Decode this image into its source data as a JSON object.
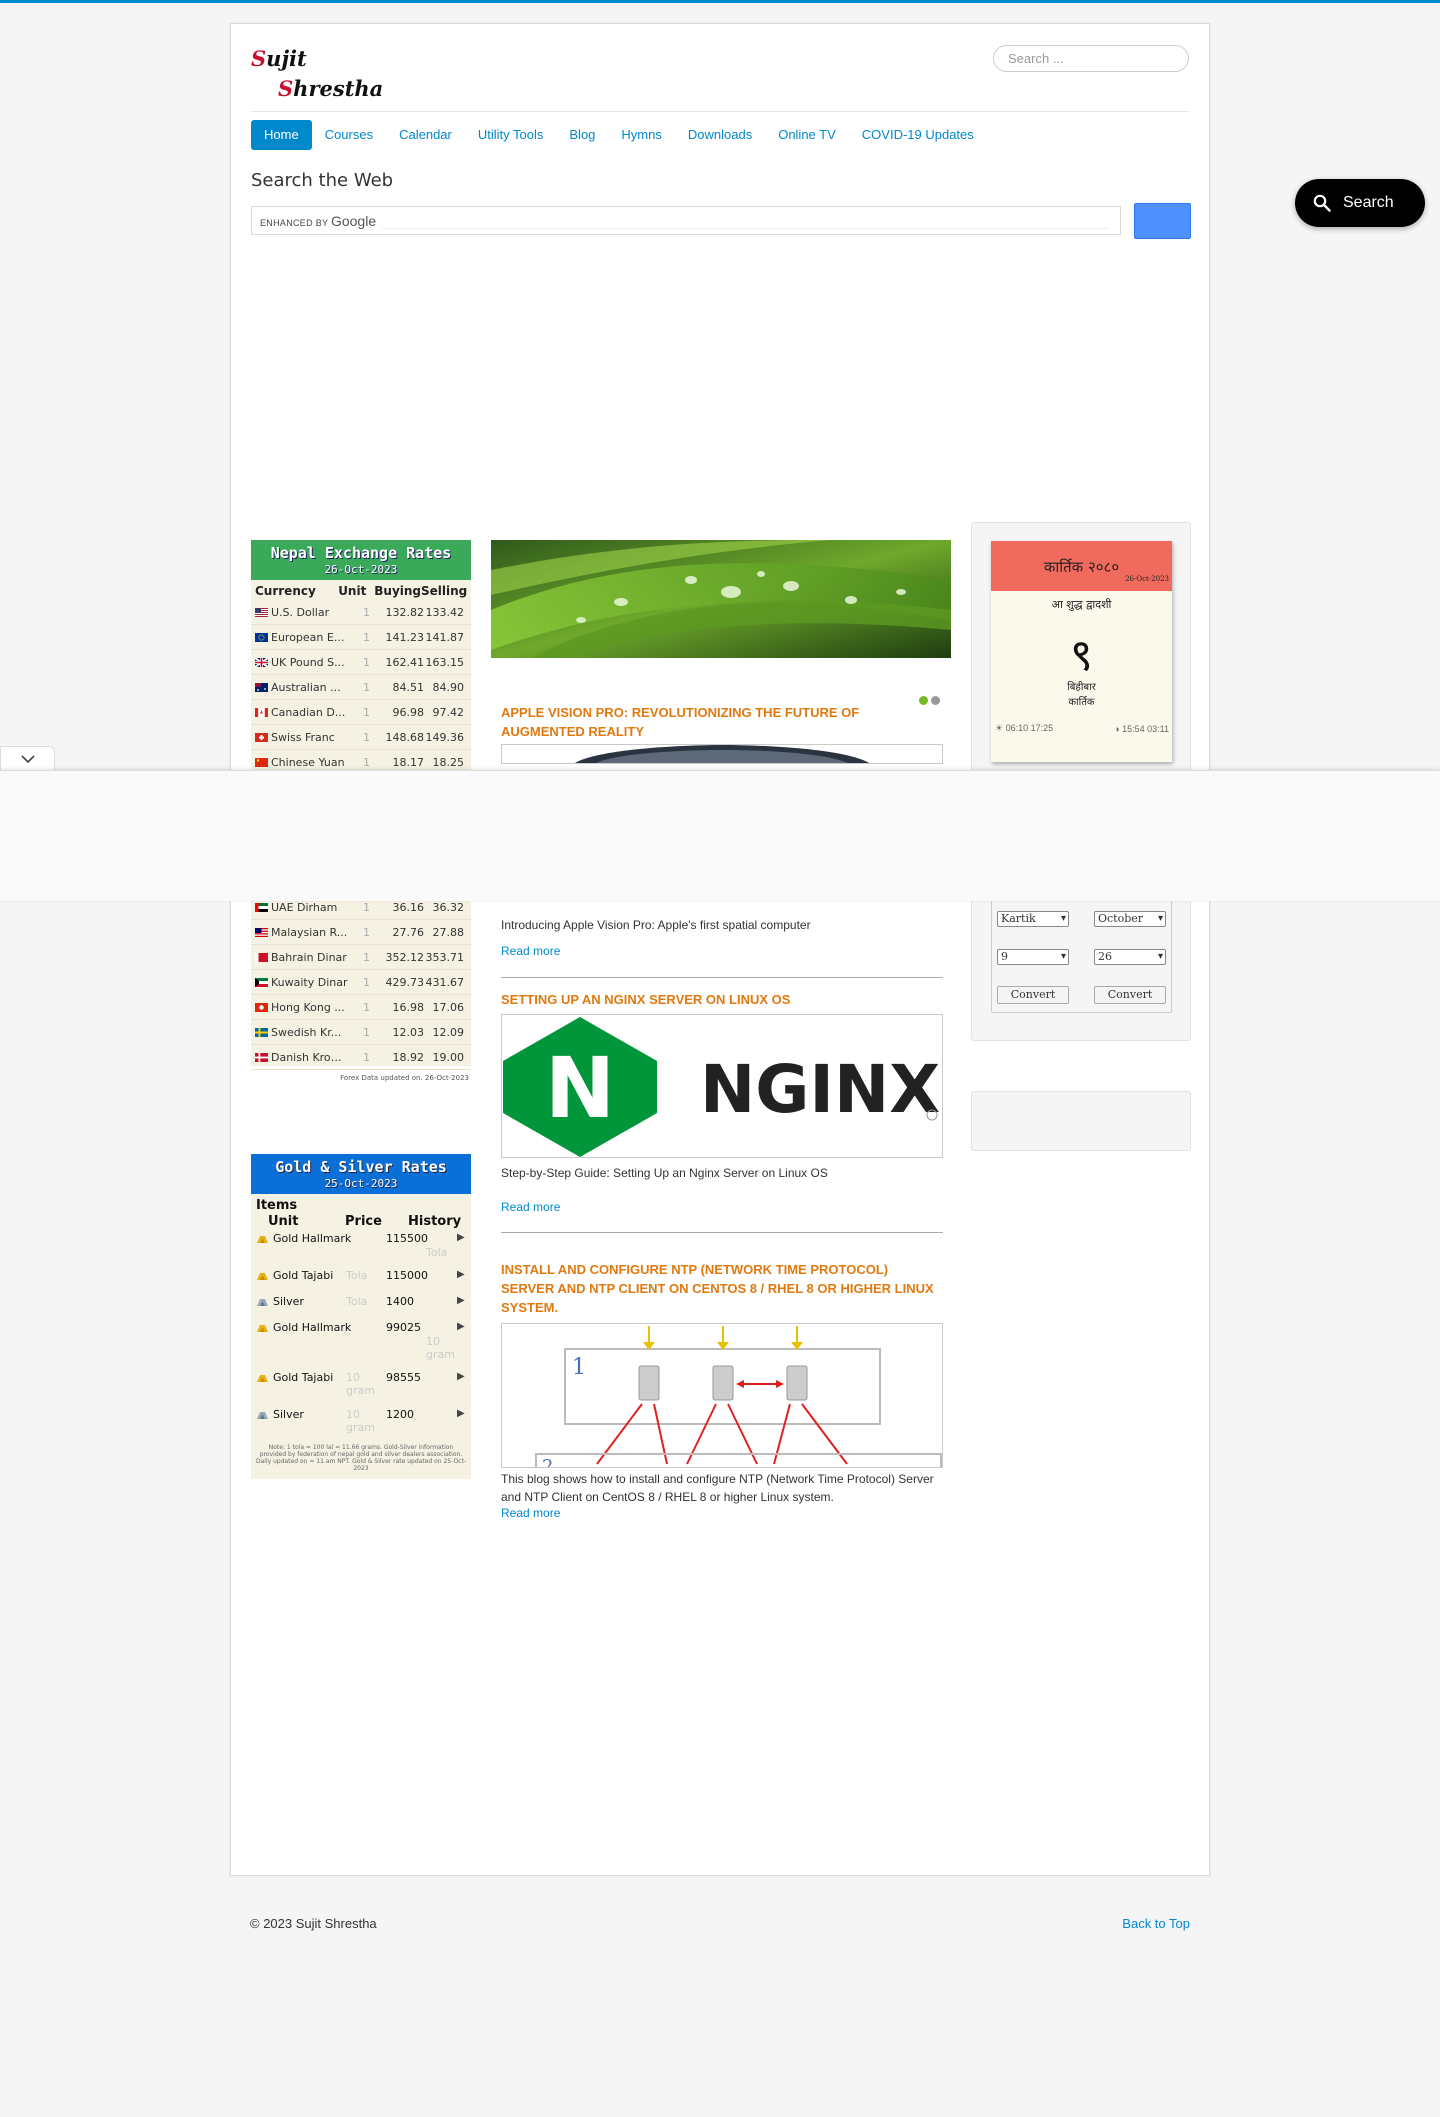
{
  "header": {
    "brand_line1_cap": "S",
    "brand_line1_rest": "ujit",
    "brand_line2_cap": "S",
    "brand_line2_rest": "hrestha",
    "search_placeholder": "Search ..."
  },
  "nav": {
    "items": [
      {
        "label": "Home"
      },
      {
        "label": "Courses"
      },
      {
        "label": "Calendar"
      },
      {
        "label": "Utility Tools"
      },
      {
        "label": "Blog"
      },
      {
        "label": "Hymns"
      },
      {
        "label": "Downloads"
      },
      {
        "label": "Online TV"
      },
      {
        "label": "COVID-19 Updates"
      }
    ]
  },
  "search_web": {
    "title": "Search the Web",
    "enhanced_by": "ENHANCED BY",
    "google": "Google"
  },
  "float_search": {
    "label": "Search"
  },
  "forex": {
    "title": "Nepal Exchange Rates",
    "date": "26-Oct-2023",
    "col_currency": "Currency",
    "col_unit": "Unit",
    "col_buying": "Buying",
    "col_selling": "Selling",
    "rows": [
      {
        "name": "U.S. Dollar",
        "unit": "1",
        "buy": "132.82",
        "sell": "133.42",
        "flag": "us"
      },
      {
        "name": "European E...",
        "unit": "1",
        "buy": "141.23",
        "sell": "141.87",
        "flag": "eu"
      },
      {
        "name": "UK Pound S...",
        "unit": "1",
        "buy": "162.41",
        "sell": "163.15",
        "flag": "uk"
      },
      {
        "name": "Australian ...",
        "unit": "1",
        "buy": "84.51",
        "sell": "84.90",
        "flag": "au"
      },
      {
        "name": "Canadian D...",
        "unit": "1",
        "buy": "96.98",
        "sell": "97.42",
        "flag": "ca"
      },
      {
        "name": "Swiss Franc",
        "unit": "1",
        "buy": "148.68",
        "sell": "149.36",
        "flag": "ch"
      },
      {
        "name": "Chinese Yuan",
        "unit": "1",
        "buy": "18.17",
        "sell": "18.25",
        "flag": "cn"
      }
    ],
    "rows2": [
      {
        "name": "UAE Dirham",
        "unit": "1",
        "buy": "36.16",
        "sell": "36.32",
        "flag": "ae"
      },
      {
        "name": "Malaysian R...",
        "unit": "1",
        "buy": "27.76",
        "sell": "27.88",
        "flag": "my"
      },
      {
        "name": "Bahrain Dinar",
        "unit": "1",
        "buy": "352.12",
        "sell": "353.71",
        "flag": "bh"
      },
      {
        "name": "Kuwaity Dinar",
        "unit": "1",
        "buy": "429.73",
        "sell": "431.67",
        "flag": "kw"
      },
      {
        "name": "Hong Kong ...",
        "unit": "1",
        "buy": "16.98",
        "sell": "17.06",
        "flag": "hk"
      },
      {
        "name": "Swedish Kr...",
        "unit": "1",
        "buy": "12.03",
        "sell": "12.09",
        "flag": "se"
      },
      {
        "name": "Danish Kron...",
        "unit": "1",
        "buy": "18.92",
        "sell": "19.00",
        "flag": "dk"
      }
    ],
    "footer": "Forex Data updated on. 26-Oct-2023"
  },
  "gold": {
    "title": "Gold & Silver Rates",
    "date": "25-Oct-2023",
    "col_items": "Items",
    "col_unit": "Unit",
    "col_price": "Price",
    "col_history": "History",
    "rows": [
      {
        "name": "Gold Hallmark",
        "unit": "Tola",
        "price": "115500"
      },
      {
        "name": "Gold Tajabi",
        "unit": "Tola",
        "price": "115000"
      },
      {
        "name": "Silver",
        "unit": "Tola",
        "price": "1400"
      },
      {
        "name": "Gold Hallmark",
        "unit": "10 gram",
        "price": "99025"
      },
      {
        "name": "Gold Tajabi",
        "unit": "10 gram",
        "price": "98555"
      },
      {
        "name": "Silver",
        "unit": "10 gram",
        "price": "1200"
      }
    ],
    "arrow": "▶",
    "note": "Note: 1 tola = 100 lal = 11.66 grams. Gold-Silver information provided by federation of nepal gold and silver dealers association. Daily updated on ≈ 11 am NPT. Gold & Silver rate updated on 25-Oct-2023"
  },
  "posts": [
    {
      "title": "Apple Vision Pro: Revolutionizing the Future of Augmented Reality",
      "text": "Introducing Apple Vision Pro: Apple's first spatial computer",
      "read_more": "Read more"
    },
    {
      "title": "Setting up an Nginx server on Linux OS",
      "logo_letter": "N",
      "logo_text": "NGINX",
      "text": "Step-by-Step Guide: Setting Up an Nginx Server on Linux OS",
      "read_more": "Read more"
    },
    {
      "title": "Install and configure NTP (Network Time Protocol) Server and NTP Client on CentOS 8 / RHEL 8 or higher Linux system.",
      "diagram_1": "1",
      "diagram_2": "2",
      "text": "This blog shows how to install and configure NTP (Network Time Protocol) Server and NTP Client on CentOS 8 / RHEL 8 or higher Linux system.",
      "read_more": "Read more"
    }
  ],
  "calendar": {
    "month_nepali": "कार्तिक २०८०",
    "date": "26-Oct-2023",
    "tithi": "आ शुद्ध द्वादशी",
    "big_day": "९",
    "line1": "बिहीबार",
    "line2": "कार्तिक",
    "sunrise": "☀ 06:10 17:25",
    "moon": "◑ 15:54 03:11"
  },
  "converter": {
    "month_bs": "Kartik",
    "month_ad": "October",
    "day_bs": "9",
    "day_ad": "26",
    "convert_label": "Convert"
  },
  "footer": {
    "copyright": "© 2023 Sujit Shrestha",
    "back_to_top": "Back to Top"
  }
}
